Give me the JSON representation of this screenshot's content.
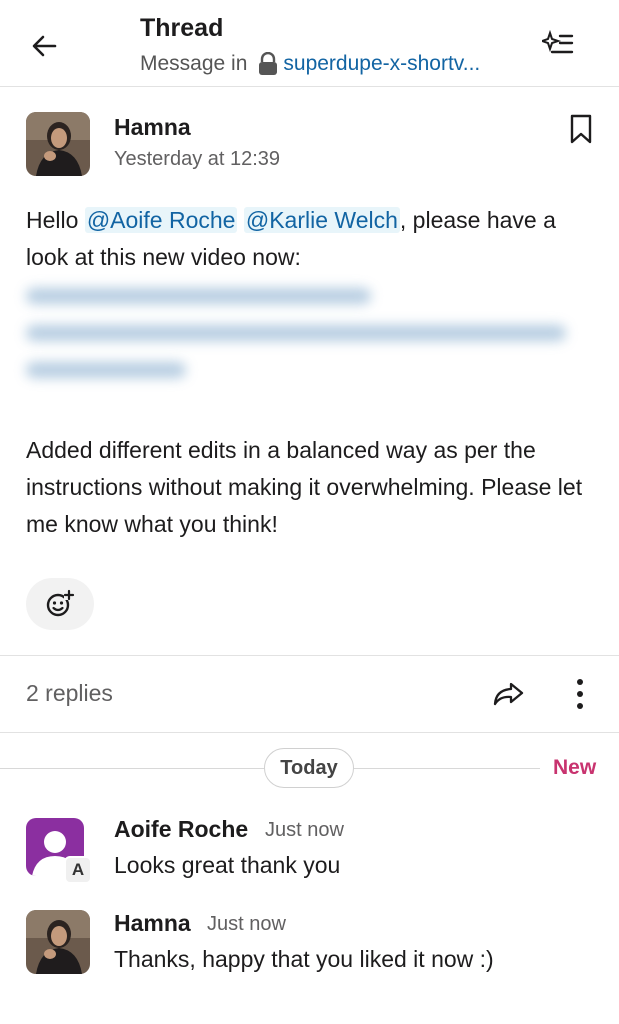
{
  "header": {
    "title": "Thread",
    "subtitle_prefix": "Message in",
    "channel": "superdupe-x-shortv..."
  },
  "parent_message": {
    "author": "Hamna",
    "timestamp": "Yesterday at 12:39",
    "text_before": "Hello ",
    "mention_1": "@Aoife Roche",
    "mention_2": "@Karlie Welch",
    "text_after": ", please have a look at this new video now:",
    "paragraph_2": "Added different edits in a balanced way as per the instructions without making it overwhelming. Please let me know what you think!"
  },
  "thread_meta": {
    "replies_count": "2 replies"
  },
  "separator": {
    "today_label": "Today",
    "new_label": "New"
  },
  "replies": [
    {
      "author": "Aoife Roche",
      "time": "Just now",
      "text": "Looks great thank you",
      "avatar_badge": "A"
    },
    {
      "author": "Hamna",
      "time": "Just now",
      "text": "Thanks, happy that you liked it now :)"
    }
  ],
  "colors": {
    "link": "#1264a3",
    "new_accent": "#c8336f",
    "generic_avatar": "#8b2fa0"
  },
  "icons": {
    "back": "arrow-left-icon",
    "header_action": "sparkle-list-icon",
    "lock": "lock-icon",
    "bookmark": "bookmark-icon",
    "add_reaction": "add-reaction-icon",
    "share": "share-arrow-icon",
    "more": "more-vertical-icon"
  }
}
